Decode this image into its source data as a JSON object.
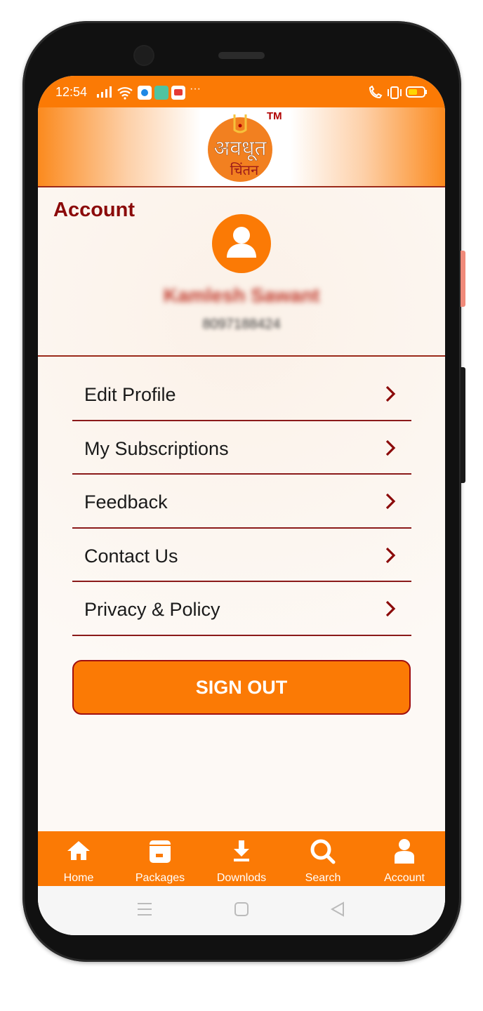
{
  "status_bar": {
    "time": "12:54"
  },
  "header": {
    "logo_text": "अवधूत चिंतन",
    "trademark": "TM"
  },
  "account": {
    "title": "Account",
    "user_name": "Kamlesh Sawant",
    "user_phone": "8097188424"
  },
  "menu": [
    {
      "label": "Edit Profile"
    },
    {
      "label": "My Subscriptions"
    },
    {
      "label": "Feedback"
    },
    {
      "label": "Contact Us"
    },
    {
      "label": "Privacy & Policy"
    }
  ],
  "sign_out": "SIGN OUT",
  "bottom_nav": [
    {
      "label": "Home",
      "icon": "home-icon"
    },
    {
      "label": "Packages",
      "icon": "package-icon"
    },
    {
      "label": "Downlods",
      "icon": "download-icon"
    },
    {
      "label": "Search",
      "icon": "search-icon"
    },
    {
      "label": "Account",
      "icon": "user-icon"
    }
  ],
  "colors": {
    "accent": "#fb7a05",
    "title": "#8b0a0a",
    "divider": "#9b2a1a"
  }
}
